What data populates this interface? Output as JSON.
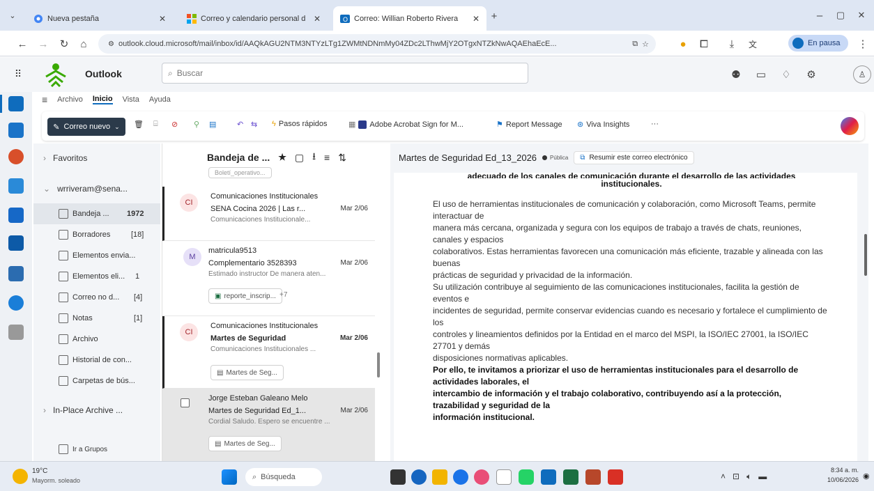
{
  "browser": {
    "tabs": [
      {
        "title": "Nueva pestaña",
        "active": false
      },
      {
        "title": "Correo y calendario personal d",
        "active": false
      },
      {
        "title": "Correo: Willian Roberto Rivera",
        "active": true
      }
    ],
    "url": "outlook.cloud.microsoft/mail/inbox/id/AAQkAGU2NTM3NTYzLTg1ZWMtNDNmMy04ZDc2LThwMjY2OTgxNTZkNwAQAEhaEcE...",
    "profile_label": "En pausa"
  },
  "app": {
    "name": "Outlook",
    "search_placeholder": "Buscar"
  },
  "menu": {
    "items": [
      "Archivo",
      "Inicio",
      "Vista",
      "Ayuda"
    ],
    "active": "Inicio"
  },
  "ribbon": {
    "new_mail": "Correo nuevo",
    "quick_steps": "Pasos rápidos",
    "adobe": "Adobe Acrobat Sign for M...",
    "report": "Report Message",
    "viva": "Viva Insights",
    "more": "···"
  },
  "folders": {
    "favorites": "Favoritos",
    "account": "wrriveram@sena...",
    "items": [
      {
        "label": "Bandeja ...",
        "count": "1972"
      },
      {
        "label": "Borradores",
        "count": "[18]"
      },
      {
        "label": "Elementos envia...",
        "count": ""
      },
      {
        "label": "Elementos eli...",
        "count": "1"
      },
      {
        "label": "Correo no d...",
        "count": "[4]"
      },
      {
        "label": "Notas",
        "count": "[1]"
      },
      {
        "label": "Archivo",
        "count": ""
      },
      {
        "label": "Historial de con...",
        "count": ""
      },
      {
        "label": "Carpetas de bús...",
        "count": ""
      }
    ],
    "in_place": "In-Place Archive ...",
    "groups": "Ir a Grupos"
  },
  "list": {
    "header": "Bandeja de ...",
    "top_chip": "Boletí_operativo...",
    "messages": [
      {
        "initials": "CI",
        "sender": "Comunicaciones Institucionales",
        "subject": "SENA Cocina 2026 | Las r...",
        "date": "Mar 2/06",
        "preview": "Comunicaciones Institucionale...",
        "chip": ""
      },
      {
        "initials": "M",
        "sender": "matricula9513",
        "subject": "Complementario 3528393",
        "date": "Mar 2/06",
        "preview": "Estimado instructor De manera aten...",
        "chip": "reporte_inscrip...",
        "chip_extra": "+7"
      },
      {
        "initials": "CI",
        "sender": "Comunicaciones Institucionales",
        "subject": "Martes de Seguridad",
        "date": "Mar 2/06",
        "preview": "Comunicaciones Institucionales ...",
        "chip": "Martes de Seg..."
      },
      {
        "initials": "",
        "sender": "Jorge Esteban Galeano Melo",
        "subject": "Martes de Seguridad Ed_1...",
        "date": "Mar 2/06",
        "preview": "Cordial Saludo. Espero se encuentre ...",
        "chip": "Martes de Seg..."
      }
    ]
  },
  "reading": {
    "subject": "Martes de Seguridad Ed_13_2026",
    "tag": "Pública",
    "summarize": "Resumir este correo electrónico",
    "heading_cut": "adecuado de los canales de comunicación durante el desarrollo de las actividades",
    "heading": "institucionales.",
    "lines": [
      "El uso de herramientas institucionales de comunicación y colaboración, como Microsoft Teams, permite interactuar de",
      "manera más cercana, organizada y segura con los equipos de trabajo a través de chats, reuniones, canales y espacios",
      "colaborativos. Estas herramientas favorecen una comunicación más eficiente, trazable y alineada con las buenas",
      "prácticas de seguridad y privacidad de la información.",
      "Su utilización contribuye al seguimiento de las comunicaciones institucionales, facilita la gestión de eventos e",
      "incidentes de seguridad, permite conservar evidencias cuando es necesario y fortalece el cumplimiento de los",
      "controles y lineamientos definidos por la Entidad en el marco del MSPI, la ISO/IEC 27001, la ISO/IEC 27701 y demás",
      "disposiciones normativas aplicables."
    ],
    "bold_lines": [
      "Por ello, te invitamos a priorizar el uso de herramientas institucionales para el desarrollo de actividades laborales, el",
      "intercambio de información y el trabajo colaborativo, contribuyendo así a la protección, trazabilidad y seguridad de la",
      "información institucional."
    ]
  },
  "taskbar": {
    "weather_temp": "19°C",
    "weather_desc": "Mayorm. soleado",
    "search": "Búsqueda",
    "time": "8:34 a. m.",
    "date": "10/06/2026"
  },
  "colors": {
    "accent": "#0f6cbd",
    "new_mail_bg": "#2b3a4a",
    "unread_bar": "#242424"
  }
}
